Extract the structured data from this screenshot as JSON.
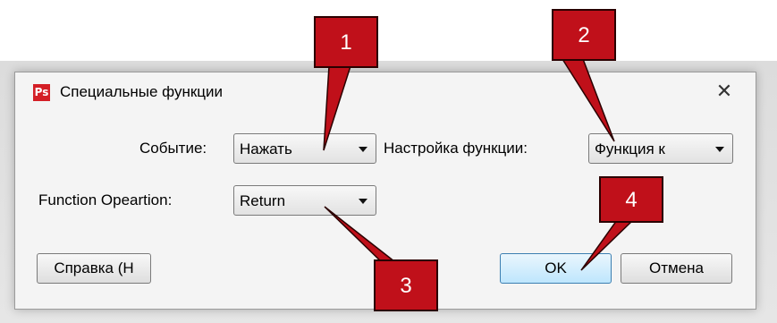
{
  "dialog": {
    "title": "Специальные функции",
    "app_icon": "Ps",
    "close_symbol": "✕"
  },
  "fields": {
    "event_label": "Событие:",
    "event_value": "Нажать",
    "function_setting_label": "Настройка функции:",
    "function_setting_value": "Функция к",
    "function_operation_label": "Function Opeartion:",
    "function_operation_value": "Return"
  },
  "buttons": {
    "help": "Справка (H",
    "ok": "OK",
    "cancel": "Отмена"
  },
  "callouts": [
    "1",
    "2",
    "3",
    "4"
  ],
  "colors": {
    "callout": "#c0101a",
    "app_icon": "#d41f26",
    "ok_button": "#bee6fd"
  }
}
